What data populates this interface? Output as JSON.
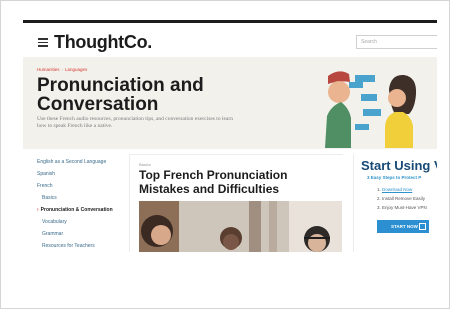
{
  "header": {
    "logo_main": "Thought",
    "logo_suffix": "Co.",
    "search_placeholder": "Search"
  },
  "hero": {
    "breadcrumb": [
      "Humanities",
      "Languages"
    ],
    "title": "Pronunciation and Conversation",
    "description": "Use these French audio resources, pronunciation tips, and conversation exercises to learn how to speak French like a native."
  },
  "sidebar": {
    "items": [
      {
        "label": "English as a Second Language"
      },
      {
        "label": "Spanish"
      },
      {
        "label": "French"
      },
      {
        "label": "Basics"
      },
      {
        "label": "Pronunciation & Conversation"
      },
      {
        "label": "Vocabulary"
      },
      {
        "label": "Grammar"
      },
      {
        "label": "Resources for Teachers"
      }
    ]
  },
  "article": {
    "category": "Basics",
    "title": "Top French Pronunciation Mistakes and Difficulties"
  },
  "ad": {
    "title": "Start Using V",
    "subtitle": "3 Easy Steps to Protect P",
    "step1_num": "1.",
    "step1": "Download Now",
    "step2": "2. Install Remove Easily",
    "step3": "3. Enjoy Must-Have VPN",
    "button": "START NOW"
  },
  "colors": {
    "accent_red": "#d63a2f",
    "ad_blue": "#2b8fd1",
    "ad_title": "#174a77",
    "hero_bg": "#f3f1ec"
  }
}
